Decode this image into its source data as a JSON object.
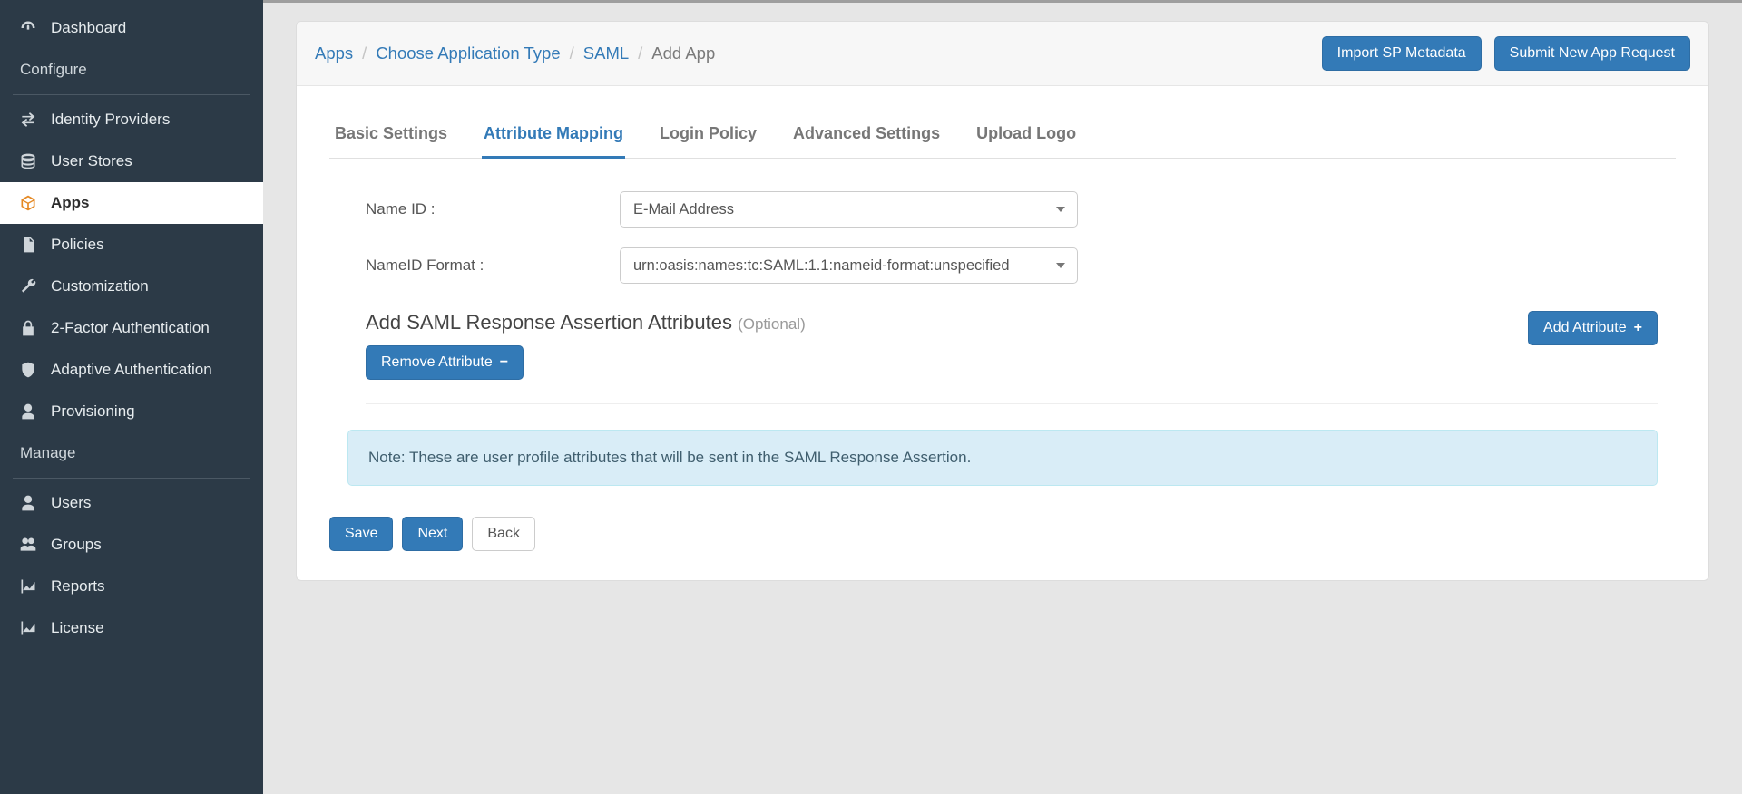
{
  "sidebar": {
    "items": [
      {
        "label": "Dashboard",
        "icon": "dashboard-icon"
      },
      {
        "label": "Configure",
        "section": true
      },
      {
        "label": "Identity Providers",
        "icon": "swap-icon"
      },
      {
        "label": "User Stores",
        "icon": "database-icon"
      },
      {
        "label": "Apps",
        "icon": "cube-icon",
        "active": true
      },
      {
        "label": "Policies",
        "icon": "document-icon"
      },
      {
        "label": "Customization",
        "icon": "wrench-icon"
      },
      {
        "label": "2-Factor Authentication",
        "icon": "lock-icon"
      },
      {
        "label": "Adaptive Authentication",
        "icon": "shield-icon"
      },
      {
        "label": "Provisioning",
        "icon": "user-icon"
      },
      {
        "label": "Manage",
        "section": true
      },
      {
        "label": "Users",
        "icon": "user-icon"
      },
      {
        "label": "Groups",
        "icon": "users-icon"
      },
      {
        "label": "Reports",
        "icon": "chart-icon"
      },
      {
        "label": "License",
        "icon": "chart-icon"
      }
    ]
  },
  "breadcrumb": {
    "items": [
      "Apps",
      "Choose Application Type",
      "SAML",
      "Add App"
    ]
  },
  "heading_actions": {
    "import_sp": "Import SP Metadata",
    "submit_request": "Submit New App Request"
  },
  "tabs": [
    {
      "label": "Basic Settings"
    },
    {
      "label": "Attribute Mapping",
      "active": true
    },
    {
      "label": "Login Policy"
    },
    {
      "label": "Advanced Settings"
    },
    {
      "label": "Upload Logo"
    }
  ],
  "form": {
    "name_id_label": "Name ID :",
    "name_id_value": "E-Mail Address",
    "nameid_format_label": "NameID Format :",
    "nameid_format_value": "urn:oasis:names:tc:SAML:1.1:nameid-format:unspecified",
    "section_title": "Add SAML Response Assertion Attributes",
    "section_optional": "(Optional)",
    "add_attribute": "Add Attribute",
    "remove_attribute": "Remove Attribute",
    "note": "Note: These are user profile attributes that will be sent in the SAML Response Assertion."
  },
  "buttons": {
    "save": "Save",
    "next": "Next",
    "back": "Back"
  }
}
